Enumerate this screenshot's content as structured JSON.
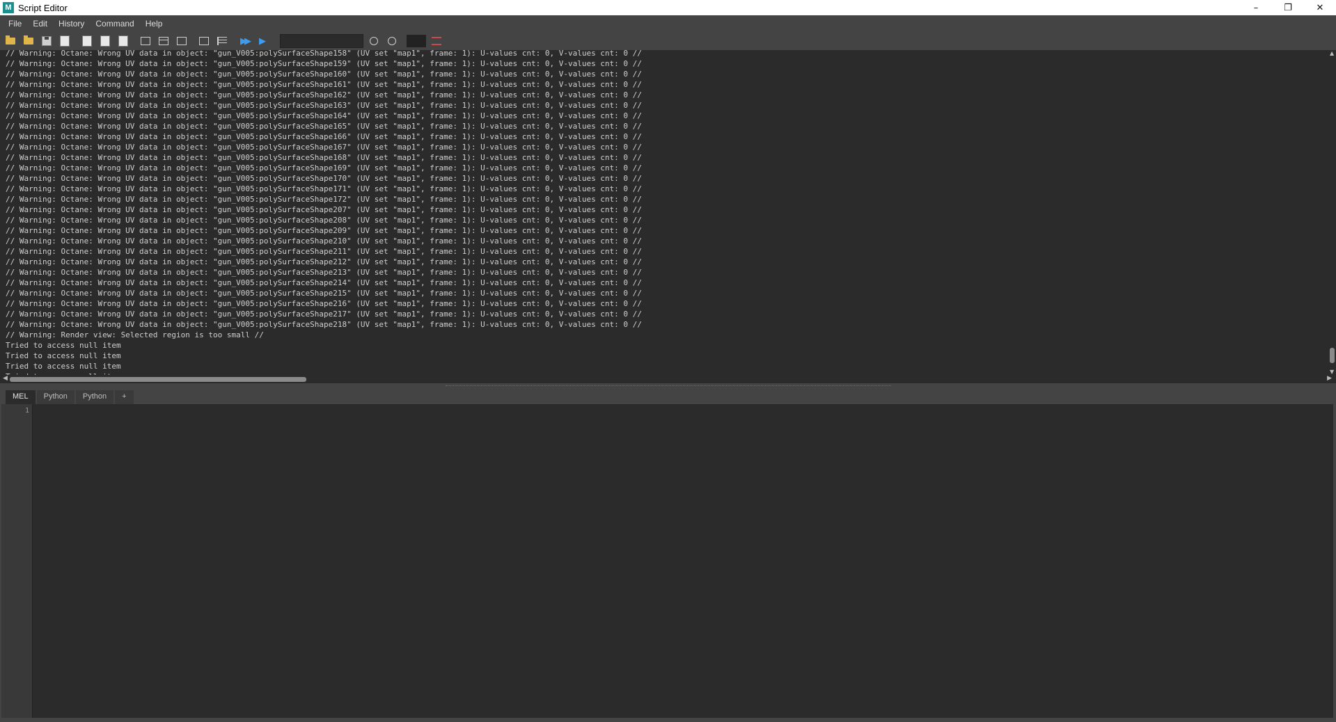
{
  "window": {
    "title": "Script Editor",
    "app_icon_letter": "M",
    "controls": {
      "minimize": "–",
      "restore": "❐",
      "close": "✕"
    }
  },
  "menu": [
    "File",
    "Edit",
    "History",
    "Command",
    "Help"
  ],
  "toolbar": {
    "icons": [
      "load-script-icon",
      "source-script-icon",
      "save-script-icon",
      "save-to-shelf-icon",
      "echo-all-icon",
      "show-line-numbers-icon",
      "show-stack-trace-icon",
      "show-history-icon",
      "show-both-icon",
      "show-input-icon",
      "clear-history-icon",
      "clear-input-icon",
      "execute-all-icon",
      "execute-icon",
      "search-icon",
      "search-options-icon",
      "quick-help-icon"
    ],
    "search_value": ""
  },
  "history": {
    "lines": [
      "// Warning: Octane: Wrong UV data in object: \"gun_V005:polySurfaceShape158\" (UV set \"map1\", frame: 1): U-values cnt: 0, V-values cnt: 0 //",
      "// Warning: Octane: Wrong UV data in object: \"gun_V005:polySurfaceShape159\" (UV set \"map1\", frame: 1): U-values cnt: 0, V-values cnt: 0 //",
      "// Warning: Octane: Wrong UV data in object: \"gun_V005:polySurfaceShape160\" (UV set \"map1\", frame: 1): U-values cnt: 0, V-values cnt: 0 //",
      "// Warning: Octane: Wrong UV data in object: \"gun_V005:polySurfaceShape161\" (UV set \"map1\", frame: 1): U-values cnt: 0, V-values cnt: 0 //",
      "// Warning: Octane: Wrong UV data in object: \"gun_V005:polySurfaceShape162\" (UV set \"map1\", frame: 1): U-values cnt: 0, V-values cnt: 0 //",
      "// Warning: Octane: Wrong UV data in object: \"gun_V005:polySurfaceShape163\" (UV set \"map1\", frame: 1): U-values cnt: 0, V-values cnt: 0 //",
      "// Warning: Octane: Wrong UV data in object: \"gun_V005:polySurfaceShape164\" (UV set \"map1\", frame: 1): U-values cnt: 0, V-values cnt: 0 //",
      "// Warning: Octane: Wrong UV data in object: \"gun_V005:polySurfaceShape165\" (UV set \"map1\", frame: 1): U-values cnt: 0, V-values cnt: 0 //",
      "// Warning: Octane: Wrong UV data in object: \"gun_V005:polySurfaceShape166\" (UV set \"map1\", frame: 1): U-values cnt: 0, V-values cnt: 0 //",
      "// Warning: Octane: Wrong UV data in object: \"gun_V005:polySurfaceShape167\" (UV set \"map1\", frame: 1): U-values cnt: 0, V-values cnt: 0 //",
      "// Warning: Octane: Wrong UV data in object: \"gun_V005:polySurfaceShape168\" (UV set \"map1\", frame: 1): U-values cnt: 0, V-values cnt: 0 //",
      "// Warning: Octane: Wrong UV data in object: \"gun_V005:polySurfaceShape169\" (UV set \"map1\", frame: 1): U-values cnt: 0, V-values cnt: 0 //",
      "// Warning: Octane: Wrong UV data in object: \"gun_V005:polySurfaceShape170\" (UV set \"map1\", frame: 1): U-values cnt: 0, V-values cnt: 0 //",
      "// Warning: Octane: Wrong UV data in object: \"gun_V005:polySurfaceShape171\" (UV set \"map1\", frame: 1): U-values cnt: 0, V-values cnt: 0 //",
      "// Warning: Octane: Wrong UV data in object: \"gun_V005:polySurfaceShape172\" (UV set \"map1\", frame: 1): U-values cnt: 0, V-values cnt: 0 //",
      "// Warning: Octane: Wrong UV data in object: \"gun_V005:polySurfaceShape207\" (UV set \"map1\", frame: 1): U-values cnt: 0, V-values cnt: 0 //",
      "// Warning: Octane: Wrong UV data in object: \"gun_V005:polySurfaceShape208\" (UV set \"map1\", frame: 1): U-values cnt: 0, V-values cnt: 0 //",
      "// Warning: Octane: Wrong UV data in object: \"gun_V005:polySurfaceShape209\" (UV set \"map1\", frame: 1): U-values cnt: 0, V-values cnt: 0 //",
      "// Warning: Octane: Wrong UV data in object: \"gun_V005:polySurfaceShape210\" (UV set \"map1\", frame: 1): U-values cnt: 0, V-values cnt: 0 //",
      "// Warning: Octane: Wrong UV data in object: \"gun_V005:polySurfaceShape211\" (UV set \"map1\", frame: 1): U-values cnt: 0, V-values cnt: 0 //",
      "// Warning: Octane: Wrong UV data in object: \"gun_V005:polySurfaceShape212\" (UV set \"map1\", frame: 1): U-values cnt: 0, V-values cnt: 0 //",
      "// Warning: Octane: Wrong UV data in object: \"gun_V005:polySurfaceShape213\" (UV set \"map1\", frame: 1): U-values cnt: 0, V-values cnt: 0 //",
      "// Warning: Octane: Wrong UV data in object: \"gun_V005:polySurfaceShape214\" (UV set \"map1\", frame: 1): U-values cnt: 0, V-values cnt: 0 //",
      "// Warning: Octane: Wrong UV data in object: \"gun_V005:polySurfaceShape215\" (UV set \"map1\", frame: 1): U-values cnt: 0, V-values cnt: 0 //",
      "// Warning: Octane: Wrong UV data in object: \"gun_V005:polySurfaceShape216\" (UV set \"map1\", frame: 1): U-values cnt: 0, V-values cnt: 0 //",
      "// Warning: Octane: Wrong UV data in object: \"gun_V005:polySurfaceShape217\" (UV set \"map1\", frame: 1): U-values cnt: 0, V-values cnt: 0 //",
      "// Warning: Octane: Wrong UV data in object: \"gun_V005:polySurfaceShape218\" (UV set \"map1\", frame: 1): U-values cnt: 0, V-values cnt: 0 //",
      "// Warning: Render view: Selected region is too small //",
      "Tried to access null item",
      "Tried to access null item",
      "Tried to access null item",
      "Tried to access null item"
    ]
  },
  "tabs": [
    {
      "label": "MEL",
      "active": true
    },
    {
      "label": "Python",
      "active": false
    },
    {
      "label": "Python",
      "active": false
    },
    {
      "label": "+",
      "active": false
    }
  ],
  "editor": {
    "line_number": "1",
    "content": ""
  },
  "colors": {
    "panel": "#444444",
    "text_area": "#2b2b2b",
    "text": "#cfcfcf",
    "accent": "#3b9cf0"
  }
}
